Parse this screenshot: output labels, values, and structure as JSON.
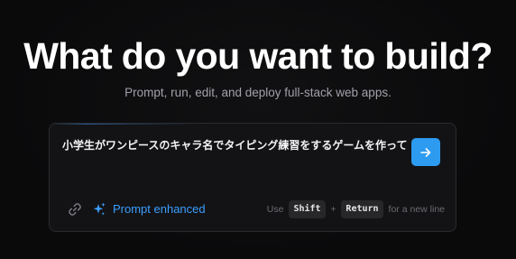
{
  "hero": {
    "title": "What do you want to build?",
    "subtitle": "Prompt, run, edit, and deploy full-stack web apps."
  },
  "prompt": {
    "text": "小学生がワンピースのキャラ名でタイピング練習をするゲームを作って",
    "send_icon": "arrow-right-icon"
  },
  "toolbar": {
    "attach_icon": "link-icon",
    "enhanced_icon": "sparkles-icon",
    "enhanced_label": "Prompt enhanced",
    "hint_use": "Use",
    "hint_key1": "Shift",
    "hint_plus": "+",
    "hint_key2": "Return",
    "hint_tail": "for a new line"
  },
  "colors": {
    "background": "#0a0a0b",
    "accent": "#2d9bf0",
    "enhanced_text": "#3b9eff"
  }
}
